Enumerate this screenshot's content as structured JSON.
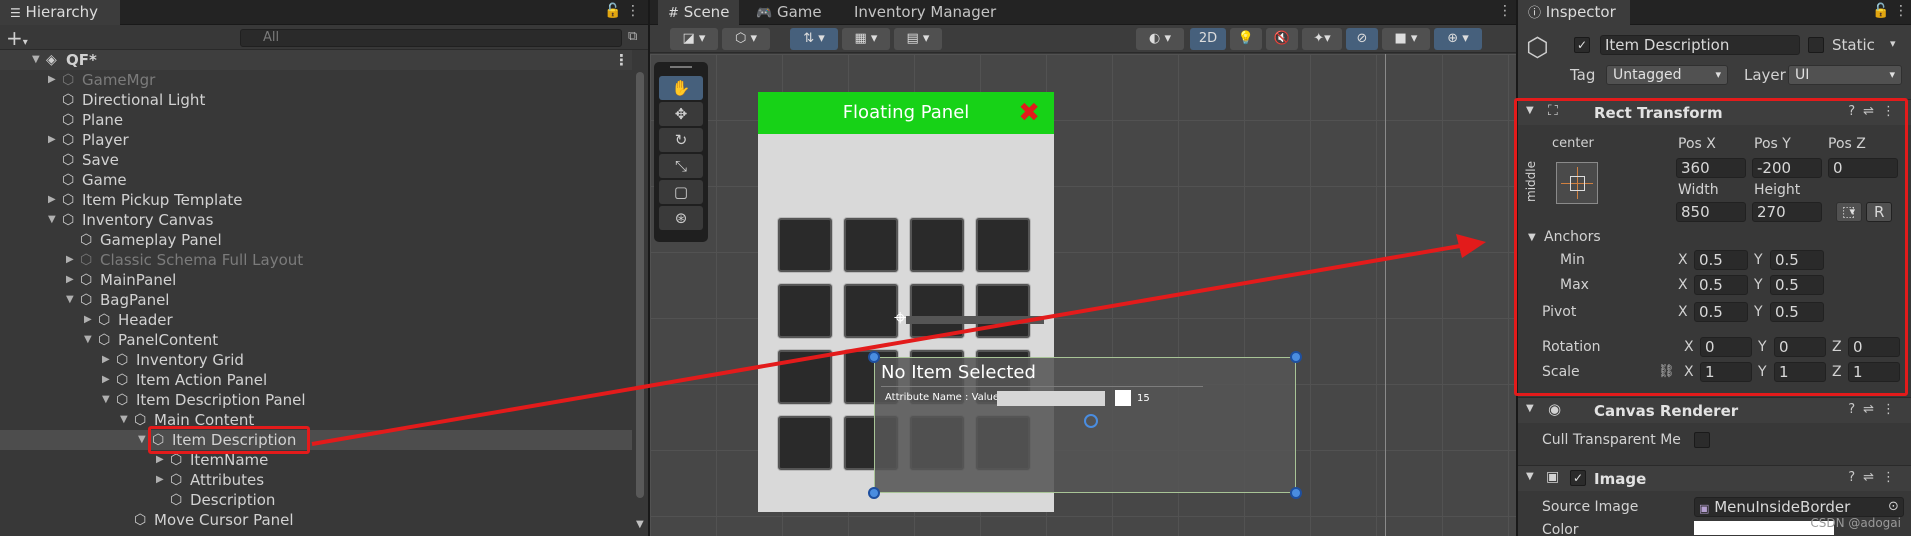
{
  "hierarchy": {
    "tab_label": "Hierarchy",
    "search_placeholder": "All",
    "items": [
      {
        "label": "QF*",
        "depth": 0,
        "expand": "open",
        "dim": false,
        "icon": "unity-scene-icon"
      },
      {
        "label": "GameMgr",
        "depth": 1,
        "expand": "closed",
        "dim": true,
        "icon": "cube-icon"
      },
      {
        "label": "Directional Light",
        "depth": 1,
        "expand": "none",
        "dim": false,
        "icon": "cube-icon"
      },
      {
        "label": "Plane",
        "depth": 1,
        "expand": "none",
        "dim": false,
        "icon": "cube-icon"
      },
      {
        "label": "Player",
        "depth": 1,
        "expand": "closed",
        "dim": false,
        "icon": "cube-icon"
      },
      {
        "label": "Save",
        "depth": 1,
        "expand": "none",
        "dim": false,
        "icon": "cube-icon"
      },
      {
        "label": "Game",
        "depth": 1,
        "expand": "none",
        "dim": false,
        "icon": "cube-icon"
      },
      {
        "label": "Item Pickup Template",
        "depth": 1,
        "expand": "closed",
        "dim": false,
        "icon": "cube-icon"
      },
      {
        "label": "Inventory Canvas",
        "depth": 1,
        "expand": "open",
        "dim": false,
        "icon": "cube-icon"
      },
      {
        "label": "Gameplay Panel",
        "depth": 2,
        "expand": "none",
        "dim": false,
        "icon": "cube-icon"
      },
      {
        "label": "Classic Schema Full Layout",
        "depth": 2,
        "expand": "closed",
        "dim": true,
        "icon": "cube-icon"
      },
      {
        "label": "MainPanel",
        "depth": 2,
        "expand": "closed",
        "dim": false,
        "icon": "cube-icon"
      },
      {
        "label": "BagPanel",
        "depth": 2,
        "expand": "open",
        "dim": false,
        "icon": "cube-icon"
      },
      {
        "label": "Header",
        "depth": 3,
        "expand": "closed",
        "dim": false,
        "icon": "cube-icon"
      },
      {
        "label": "PanelContent",
        "depth": 3,
        "expand": "open",
        "dim": false,
        "icon": "cube-icon"
      },
      {
        "label": "Inventory Grid",
        "depth": 4,
        "expand": "closed",
        "dim": false,
        "icon": "cube-icon"
      },
      {
        "label": "Item Action Panel",
        "depth": 4,
        "expand": "closed",
        "dim": false,
        "icon": "cube-icon"
      },
      {
        "label": "Item Description Panel",
        "depth": 4,
        "expand": "open",
        "dim": false,
        "icon": "cube-icon"
      },
      {
        "label": "Main Content",
        "depth": 5,
        "expand": "open",
        "dim": false,
        "icon": "cube-icon"
      },
      {
        "label": "Item Description",
        "depth": 6,
        "expand": "open",
        "dim": false,
        "icon": "cube-icon",
        "selected": true
      },
      {
        "label": "ItemName",
        "depth": 7,
        "expand": "closed",
        "dim": false,
        "icon": "cube-icon"
      },
      {
        "label": "Attributes",
        "depth": 7,
        "expand": "closed",
        "dim": false,
        "icon": "cube-icon"
      },
      {
        "label": "Description",
        "depth": 7,
        "expand": "none",
        "dim": false,
        "icon": "cube-icon"
      },
      {
        "label": "Move Cursor Panel",
        "depth": 5,
        "expand": "none",
        "dim": false,
        "icon": "cube-icon"
      }
    ]
  },
  "scene": {
    "tabs": [
      {
        "label": "Scene",
        "icon": "grid-icon",
        "active": true
      },
      {
        "label": "Game",
        "icon": "gamepad-icon",
        "active": false
      },
      {
        "label": "Inventory Manager",
        "icon": "",
        "active": false
      }
    ],
    "mode_2d_label": "2D",
    "panel_title": "Floating Panel",
    "description": {
      "title": "No Item Selected",
      "attribute_text": "Attribute Name : Value",
      "attribute_value": "15"
    }
  },
  "inspector": {
    "tab_label": "Inspector",
    "object_name": "Item Description",
    "static_label": "Static",
    "tag_label": "Tag",
    "tag_value": "Untagged",
    "layer_label": "Layer",
    "layer_value": "UI",
    "rect_transform": {
      "title": "Rect Transform",
      "anchor_h": "center",
      "anchor_v": "middle",
      "pos_x_label": "Pos X",
      "pos_x": "360",
      "pos_y_label": "Pos Y",
      "pos_y": "-200",
      "pos_z_label": "Pos Z",
      "pos_z": "0",
      "width_label": "Width",
      "width": "850",
      "height_label": "Height",
      "height": "270",
      "r_label": "R",
      "anchors_label": "Anchors",
      "min_label": "Min",
      "min_x": "0.5",
      "min_y": "0.5",
      "max_label": "Max",
      "max_x": "0.5",
      "max_y": "0.5",
      "pivot_label": "Pivot",
      "pivot_x": "0.5",
      "pivot_y": "0.5",
      "rotation_label": "Rotation",
      "rot_x": "0",
      "rot_y": "0",
      "rot_z": "0",
      "scale_label": "Scale",
      "scale_x": "1",
      "scale_y": "1",
      "scale_z": "1",
      "x": "X",
      "y": "Y",
      "z": "Z"
    },
    "canvas_renderer": {
      "title": "Canvas Renderer",
      "cull_label": "Cull Transparent Me"
    },
    "image": {
      "title": "Image",
      "source_label": "Source Image",
      "source_value": "MenuInsideBorder",
      "color_label": "Color"
    }
  },
  "watermark": "CSDN @adogai"
}
